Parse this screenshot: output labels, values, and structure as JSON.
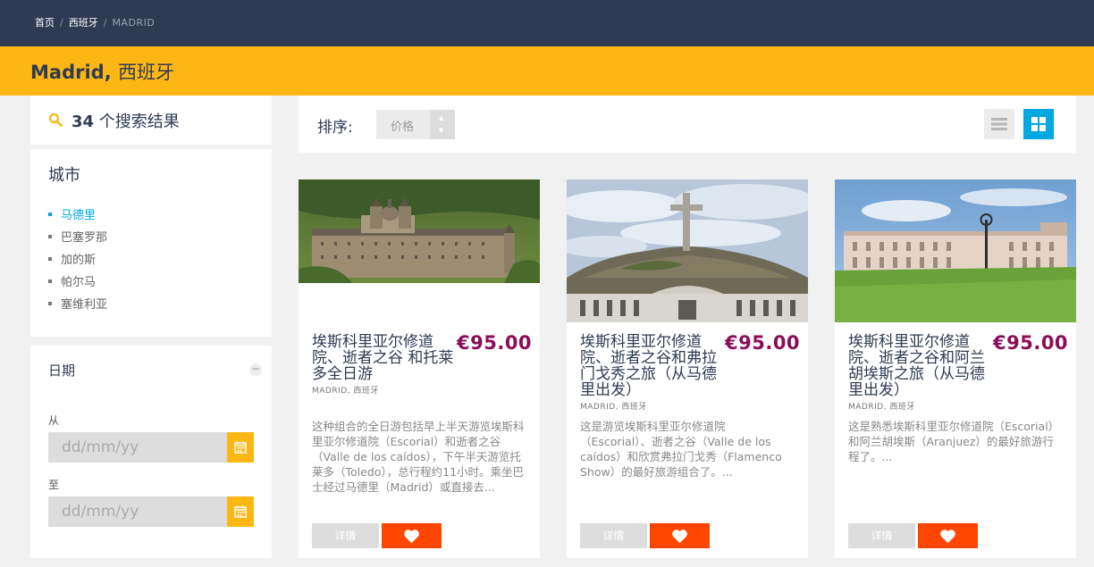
{
  "breadcrumb": {
    "home": "首页",
    "country": "西班牙",
    "current": "MADRID",
    "separator": "/"
  },
  "page": {
    "title_city": "Madrid,",
    "title_country": "西班牙"
  },
  "results": {
    "count": "34",
    "label": "个搜索结果"
  },
  "city_filter": {
    "title": "城市",
    "items": [
      {
        "label": "马德里",
        "active": true
      },
      {
        "label": "巴塞罗那",
        "active": false
      },
      {
        "label": "加的斯",
        "active": false
      },
      {
        "label": "帕尔马",
        "active": false
      },
      {
        "label": "塞维利亚",
        "active": false
      }
    ]
  },
  "date_filter": {
    "title": "日期",
    "collapse_symbol": "−",
    "from_label": "从",
    "to_label": "至",
    "from_placeholder": "dd/mm/yy",
    "to_placeholder": "dd/mm/yy"
  },
  "sort": {
    "label": "排序:",
    "value": "价格",
    "up_arrow": "▲",
    "down_arrow": "▼"
  },
  "tours": [
    {
      "name": "埃斯科里亚尔修道院、逝者之谷 和托莱多全日游",
      "price": "€95.00",
      "location": "MADRID, 西班牙",
      "description": "这种组合的全日游包括早上半天游览埃斯科里亚尔修道院（Escorial）和逝者之谷（Valle de los caídos），下午半天游览托莱多（Toledo），总行程约11小时。乘坐巴士经过马德里（Madrid）或直接去...",
      "details_label": "详情"
    },
    {
      "name": "埃斯科里亚尔修道院、逝者之谷和弗拉门戈秀之旅（从马德里出发）",
      "price": "€95.00",
      "location": "MADRID, 西班牙",
      "description": "这是游览埃斯科里亚尔修道院（Escorial）、逝者之谷（Valle de los caídos）和欣赏弗拉门戈秀（Flamenco Show）的最好旅游组合了。...",
      "details_label": "详情"
    },
    {
      "name": "埃斯科里亚尔修道院、逝者之谷和阿兰胡埃斯之旅（从马德里出发）",
      "price": "€95.00",
      "location": "MADRID, 西班牙",
      "description": "这是熟悉埃斯科里亚尔修道院（Escorial）和阿兰胡埃斯（Aranjuez）的最好旅游行程了。...",
      "details_label": "详情"
    }
  ],
  "colors": {
    "header": "#2f3b52",
    "accent_yellow": "#fdb714",
    "accent_blue": "#00a8e1",
    "price": "#8b0d5a",
    "favorite": "#ff4600"
  },
  "icons": {
    "search": "search-icon",
    "calendar": "calendar-icon",
    "list_view": "list-view-icon",
    "grid_view": "grid-view-icon",
    "favorite": "heart-icon"
  }
}
